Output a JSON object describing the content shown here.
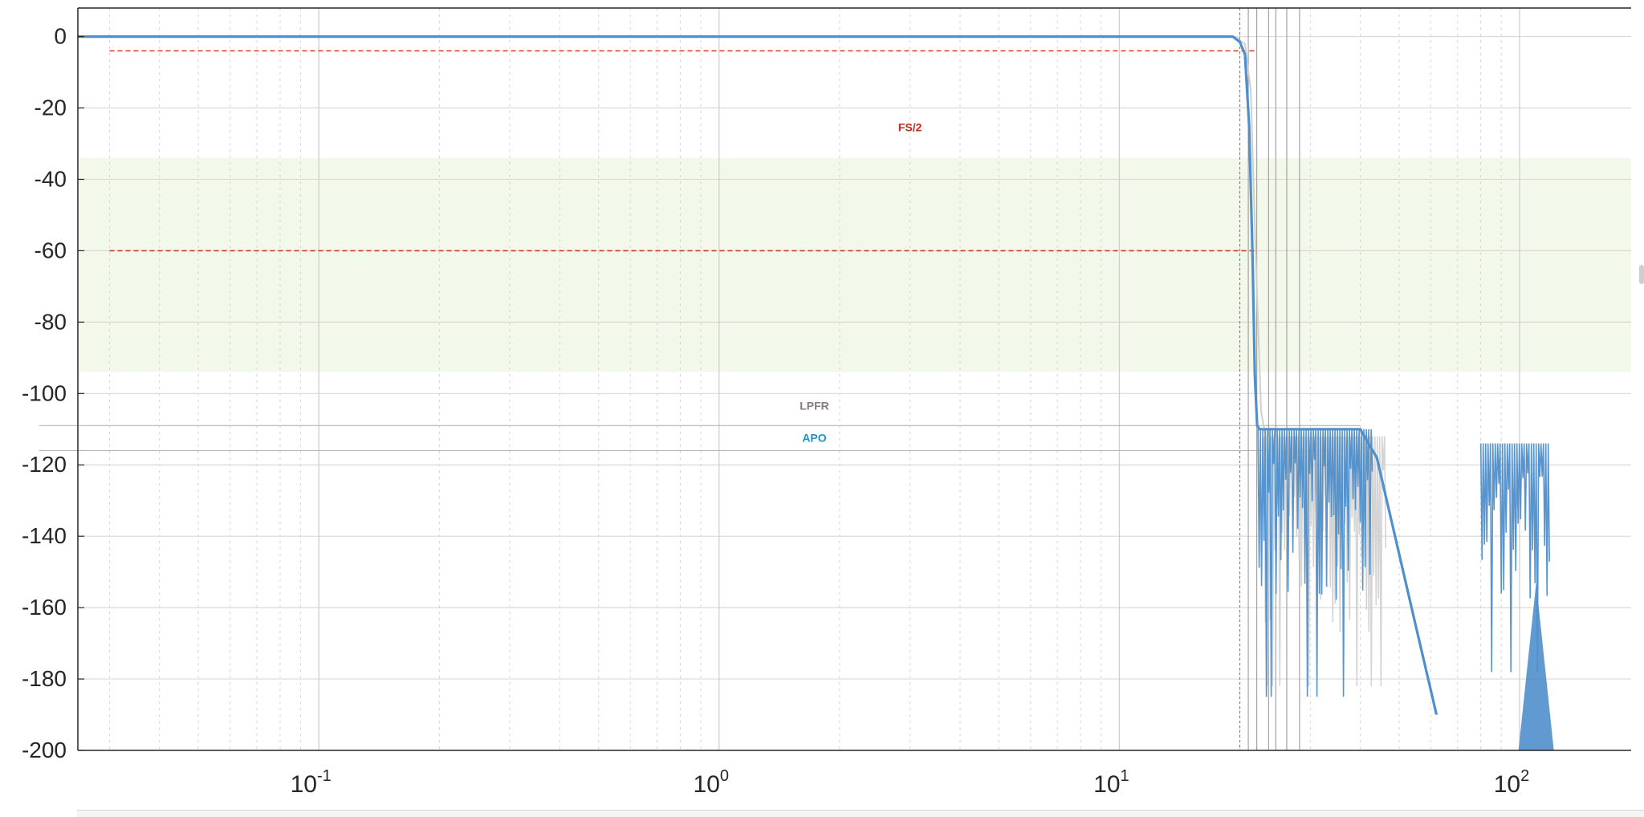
{
  "chart_data": {
    "type": "line",
    "title": "",
    "xlabel": "",
    "ylabel": "",
    "x_scale": "log",
    "xlim": [
      0.025,
      190
    ],
    "ylim": [
      -200,
      8
    ],
    "grid": true,
    "y_ticks": [
      0,
      -20,
      -40,
      -60,
      -80,
      -100,
      -120,
      -140,
      -160,
      -180,
      -200
    ],
    "x_ticks": [
      {
        "value": 0.1,
        "base": "10",
        "exp": "-1"
      },
      {
        "value": 1,
        "base": "10",
        "exp": "0"
      },
      {
        "value": 10,
        "base": "10",
        "exp": "1"
      },
      {
        "value": 100,
        "base": "10",
        "exp": "2"
      }
    ],
    "shaded_band": {
      "y_from": -34,
      "y_to": -94,
      "color": "#f3f9ea"
    },
    "reference_lines": [
      {
        "type": "dashed",
        "color": "#e0301e",
        "y": -4,
        "x_from": 0.03,
        "x_to": 21.8
      },
      {
        "type": "dashed",
        "color": "#e0301e",
        "y": -60,
        "x_from": 0.03,
        "x_to": 21.8
      },
      {
        "type": "solid",
        "color": "#b5b5b5",
        "y": -109,
        "x_from": 0.02,
        "x_to": 40
      },
      {
        "type": "solid",
        "color": "#b5b5b5",
        "y": -116,
        "x_from": 0.02,
        "x_to": 40
      }
    ],
    "vertical_lines": [
      20,
      21,
      22.05,
      23.6,
      24.6,
      26.2,
      28.2
    ],
    "series": [
      {
        "color": "#4f8fcb",
        "points": [
          [
            0.025,
            0
          ],
          [
            19.2,
            0
          ],
          [
            20,
            -1.5
          ],
          [
            20.6,
            -5
          ],
          [
            21.1,
            -25
          ],
          [
            21.5,
            -60
          ],
          [
            21.8,
            -95
          ],
          [
            22.1,
            -109
          ],
          [
            22.4,
            -110
          ],
          [
            40,
            -110
          ],
          [
            44,
            -118
          ],
          [
            55,
            -165
          ],
          [
            62,
            -190
          ]
        ],
        "ripple": [
          {
            "from": 22.2,
            "to": 43,
            "top": -110,
            "bottom": -150,
            "min_depth": -185
          },
          {
            "from": 80,
            "to": 118,
            "top": -114,
            "bottom": -150,
            "min_depth": -178
          }
        ],
        "peak": {
          "x": 110,
          "y": -153
        }
      },
      {
        "color": "#cfcfcf",
        "points": [
          [
            19.4,
            0
          ],
          [
            20.6,
            -2
          ],
          [
            21.3,
            -15
          ],
          [
            21.9,
            -60
          ],
          [
            22.6,
            -105
          ],
          [
            23.2,
            -112
          ]
        ],
        "ripple": [
          {
            "from": 23,
            "to": 46,
            "top": -112,
            "bottom": -160,
            "min_depth": -182
          }
        ]
      }
    ],
    "annotations": [
      {
        "text": "FS/2",
        "color": "#c0291a",
        "x": 3.0,
        "y": -26.5
      },
      {
        "text": "LPFR",
        "color": "#8a7a7a",
        "x": 1.73,
        "y": -104.5
      },
      {
        "text": "APO",
        "color": "#1e90c8",
        "x": 1.73,
        "y": -113.5
      }
    ]
  }
}
